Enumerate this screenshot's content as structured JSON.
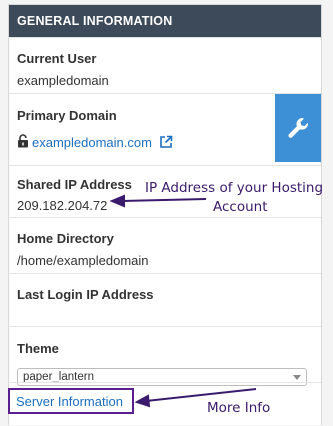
{
  "panel": {
    "title": "GENERAL INFORMATION",
    "current_user": {
      "label": "Current User",
      "value": "exampledomain"
    },
    "primary_domain": {
      "label": "Primary Domain",
      "value": "exampledomain.com"
    },
    "shared_ip": {
      "label": "Shared IP Address",
      "value": "209.182.204.72"
    },
    "home_directory": {
      "label": "Home Directory",
      "value": "/home/exampledomain"
    },
    "last_login_ip": {
      "label": "Last Login IP Address",
      "value": ""
    },
    "theme": {
      "label": "Theme",
      "selected": "paper_lantern"
    },
    "server_information": "Server Information"
  },
  "annotations": {
    "ip_note_line1": "IP Address of your Hosting",
    "ip_note_line2": "Account",
    "more_info": "More Info"
  },
  "colors": {
    "header_bg": "#3d4a5a",
    "accent_blue": "#3d8fd6",
    "link": "#1c6fbf",
    "annotation_purple": "#5b1e8f"
  }
}
